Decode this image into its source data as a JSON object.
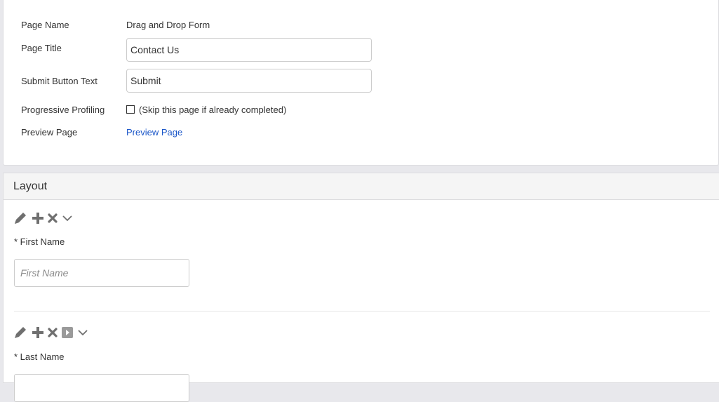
{
  "settings": {
    "page_name_label": "Page Name",
    "page_name_value": "Drag and Drop Form",
    "page_title_label": "Page Title",
    "page_title_value": "Contact Us",
    "submit_text_label": "Submit Button Text",
    "submit_text_value": "Submit",
    "progressive_label": "Progressive Profiling",
    "progressive_checkbox_text": "(Skip this page if already completed)",
    "progressive_checked": false,
    "preview_label": "Preview Page",
    "preview_link": "Preview Page"
  },
  "layout": {
    "title": "Layout",
    "fields": [
      {
        "label": "* First Name",
        "placeholder": "First Name",
        "toolbar": [
          "pencil-icon",
          "plus-icon",
          "close-icon",
          "chevron-down-icon"
        ]
      },
      {
        "label": "* Last Name",
        "placeholder": "",
        "toolbar": [
          "pencil-icon",
          "plus-icon",
          "close-icon",
          "play-box-icon",
          "chevron-down-icon"
        ]
      }
    ]
  },
  "colors": {
    "link": "#1a56c8",
    "icon": "#6f6f6f"
  }
}
